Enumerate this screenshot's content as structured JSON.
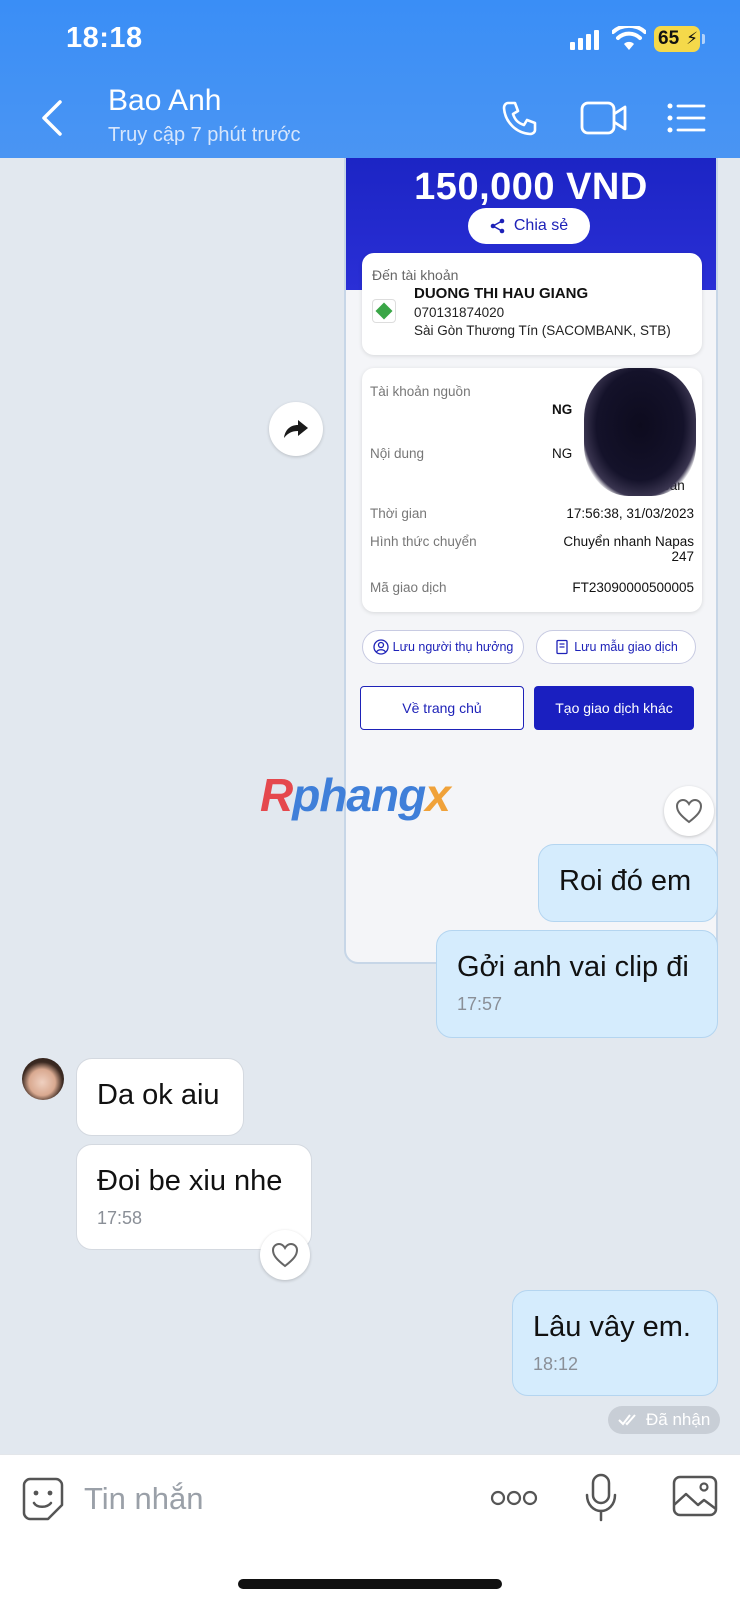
{
  "status_bar": {
    "time": "18:18",
    "battery": "65"
  },
  "header": {
    "contact_name": "Bao Anh",
    "contact_status": "Truy cập 7 phút trước"
  },
  "transfer_receipt": {
    "amount": "150,000 VND",
    "share_label": "Chia sẻ",
    "to_label": "Đến tài khoản",
    "recipient_name": "DUONG THI HAU GIANG",
    "account_number": "070131874020",
    "bank_name": "Sài Gòn Thương Tín (SACOMBANK, STB)",
    "details": [
      {
        "label": "Tài khoản nguồn",
        "value": "NG"
      },
      {
        "label": "Nội dung",
        "value": "NG"
      },
      {
        "label": "Thời gian",
        "value": "17:56:38, 31/03/2023"
      },
      {
        "label": "Hình thức chuyển",
        "value": "Chuyển nhanh Napas 247"
      },
      {
        "label": "Mã giao dịch",
        "value": "FT23090000500005"
      }
    ],
    "content_tail": "khoan",
    "save_beneficiary_label": "Lưu người thụ hưởng",
    "save_template_label": "Lưu mẫu giao dịch",
    "home_button_label": "Về trang chủ",
    "new_transaction_label": "Tạo giao dịch khác"
  },
  "watermark": {
    "r": "R",
    "mid": "phang",
    "x": "x"
  },
  "messages": [
    {
      "direction": "out",
      "text": "Roi đó em",
      "time": ""
    },
    {
      "direction": "out",
      "text": "Gởi anh vai clip đi",
      "time": "17:57"
    },
    {
      "direction": "in",
      "text": "Da ok aiu",
      "time": ""
    },
    {
      "direction": "in",
      "text": "Đoi be xiu nhe",
      "time": "17:58"
    },
    {
      "direction": "out",
      "text": "Lâu vây em.",
      "time": "18:12"
    }
  ],
  "received_status": "Đã nhận",
  "composer": {
    "placeholder": "Tin nhắn"
  },
  "colors": {
    "header_blue": "#3a8ef6",
    "outgoing_bubble": "#d5ecfd",
    "incoming_bubble": "#ffffff",
    "chat_background": "#e2e8ef",
    "receipt_blue": "#1a1fc0"
  }
}
